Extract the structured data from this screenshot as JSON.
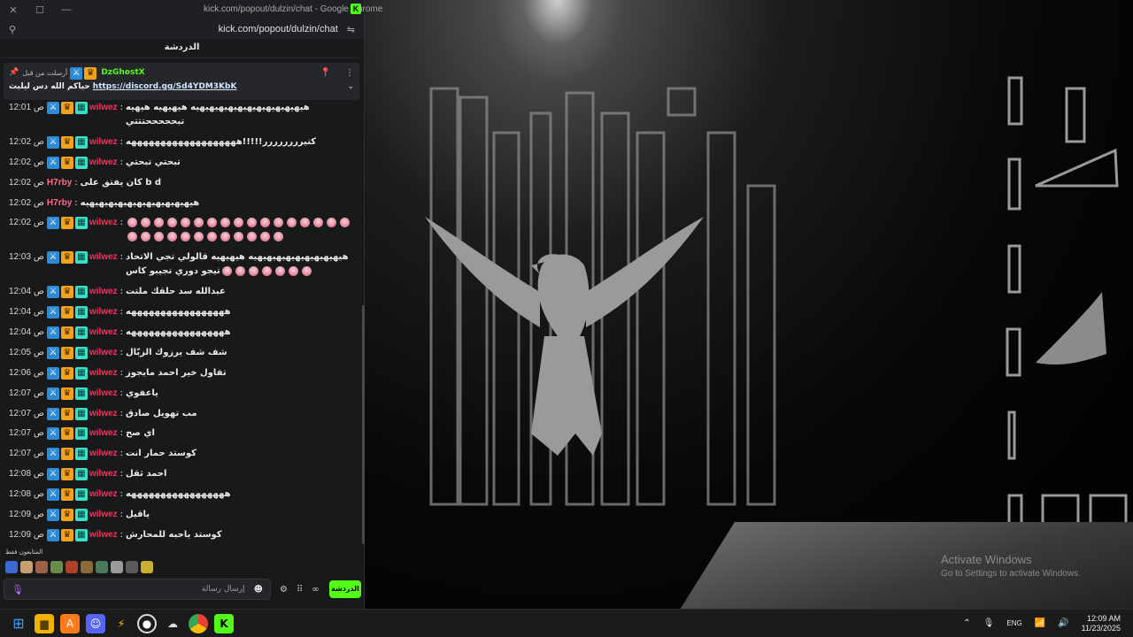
{
  "browser": {
    "title": "kick.com/popout/dulzin/chat - Google Chrome",
    "url": "kick.com/popout/dulzin/chat"
  },
  "chat": {
    "header": "الدردشة",
    "pinned": {
      "pinned_by": "أرسلت من قبل",
      "username": "DzGhostX",
      "text": "حياكم الله دس ليليث",
      "link": "https://discord.gg/Sd4YDM3KbK"
    },
    "messages": [
      {
        "time": "12:01 ص",
        "user": "wilwez",
        "color": "#ff2e5b",
        "text": "هيهيهيهيهيهيهيهيهيهيهيهيه هيهيهيه هيهيه تبحححححتتتي"
      },
      {
        "time": "12:02 ص",
        "user": "wilwez",
        "color": "#ff2e5b",
        "text": "كتيرررررررر!!!!!هههههههههههههههههههه"
      },
      {
        "time": "12:02 ص",
        "user": "wilwez",
        "color": "#ff2e5b",
        "text": "تبحتي تبحتي"
      },
      {
        "time": "12:02 ص",
        "user": "H7rby",
        "color": "#ff6b8a",
        "text": "كان يفتق على b d"
      },
      {
        "time": "12:02 ص",
        "user": "H7rby",
        "color": "#ff6b8a",
        "text": "هيهيهيهيهيهيهيهيهيهيهيهيه"
      },
      {
        "time": "12:02 ص",
        "user": "wilwez",
        "color": "#ff2e5b",
        "text": "",
        "emotes": 29
      },
      {
        "time": "12:03 ص",
        "user": "wilwez",
        "color": "#ff2e5b",
        "text": "هيهيهيهيهيهيهيهيهيهيه هيهيهيه قالولي تجي الاتحاد تيجو دوري تجيبو كاس",
        "emotes": 7
      },
      {
        "time": "12:04 ص",
        "user": "wilwez",
        "color": "#ff2e5b",
        "text": "عبدالله سد حلقك ملتت"
      },
      {
        "time": "12:04 ص",
        "user": "wilwez",
        "color": "#ff2e5b",
        "text": "هههههههههههههههههه"
      },
      {
        "time": "12:04 ص",
        "user": "wilwez",
        "color": "#ff2e5b",
        "text": "هههههههههههههههههه"
      },
      {
        "time": "12:05 ص",
        "user": "wilwez",
        "color": "#ff2e5b",
        "text": "شف شف يرزوك الزبّال"
      },
      {
        "time": "12:06 ص",
        "user": "wilwez",
        "color": "#ff2e5b",
        "text": "تفاول خير احمد مايجوز"
      },
      {
        "time": "12:07 ص",
        "user": "wilwez",
        "color": "#ff2e5b",
        "text": "ياعفوي"
      },
      {
        "time": "12:07 ص",
        "user": "wilwez",
        "color": "#ff2e5b",
        "text": "مب تهويل صادق"
      },
      {
        "time": "12:07 ص",
        "user": "wilwez",
        "color": "#ff2e5b",
        "text": "اي صح"
      },
      {
        "time": "12:07 ص",
        "user": "wilwez",
        "color": "#ff2e5b",
        "text": "كوستد حمار انت"
      },
      {
        "time": "12:08 ص",
        "user": "wilwez",
        "color": "#ff2e5b",
        "text": "احمد ثقل"
      },
      {
        "time": "12:08 ص",
        "user": "wilwez",
        "color": "#ff2e5b",
        "text": "هههههههههههههههههه"
      },
      {
        "time": "12:09 ص",
        "user": "wilwez",
        "color": "#ff2e5b",
        "text": "ياقيل"
      },
      {
        "time": "12:09 ص",
        "user": "wilwez",
        "color": "#ff2e5b",
        "text": "كوستد ياحبه للمحارش"
      }
    ],
    "viewers_label": "المتابعون فقط",
    "input_placeholder": "إرسال رسالة",
    "send_label": "الدردشة"
  },
  "desktop": {
    "activate_title": "Activate Windows",
    "activate_sub": "Go to Settings to activate Windows."
  },
  "taskbar": {
    "lang": "ENG",
    "time": "12:09 AM",
    "date": "11/23/2025"
  }
}
